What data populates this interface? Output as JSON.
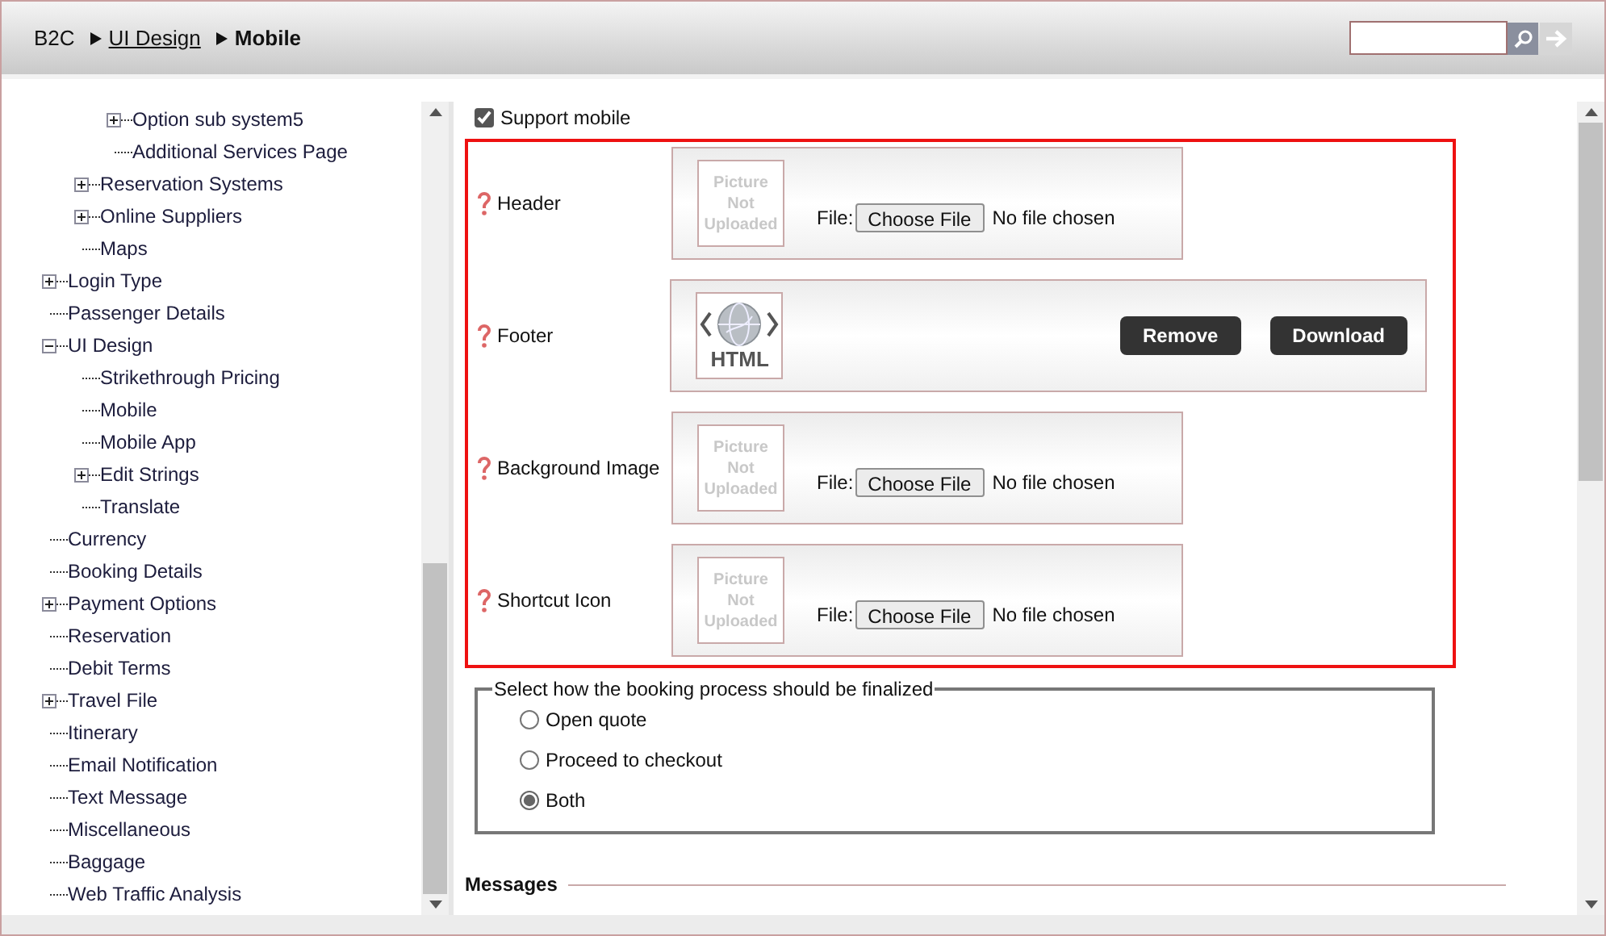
{
  "breadcrumb": [
    {
      "label": "B2C",
      "kind": "text"
    },
    {
      "label": "UI Design",
      "kind": "link"
    },
    {
      "label": "Mobile",
      "kind": "current"
    }
  ],
  "tree": [
    {
      "children": [
        {
          "children": [
            {
              "label": "Option sub system5",
              "expanded": false
            },
            {
              "label": "Additional Services Page"
            }
          ]
        },
        {
          "label": "Reservation Systems",
          "expanded": false
        },
        {
          "label": "Online Suppliers",
          "expanded": false
        },
        {
          "label": "Maps"
        }
      ]
    },
    {
      "label": "Login Type",
      "expanded": false
    },
    {
      "label": "Passenger Details"
    },
    {
      "label": "UI Design",
      "expanded": true,
      "children": [
        {
          "label": "Strikethrough Pricing"
        },
        {
          "label": "Mobile"
        },
        {
          "label": "Mobile App"
        },
        {
          "label": "Edit Strings",
          "expanded": false
        },
        {
          "label": "Translate"
        }
      ]
    },
    {
      "label": "Currency"
    },
    {
      "label": "Booking Details"
    },
    {
      "label": "Payment Options",
      "expanded": false
    },
    {
      "label": "Reservation"
    },
    {
      "label": "Debit Terms"
    },
    {
      "label": "Travel File",
      "expanded": false
    },
    {
      "label": "Itinerary"
    },
    {
      "label": "Email Notification"
    },
    {
      "label": "Text Message"
    },
    {
      "label": "Miscellaneous"
    },
    {
      "label": "Baggage"
    },
    {
      "label": "Web Traffic Analysis"
    }
  ],
  "support_mobile": {
    "label": "Support mobile",
    "checked": true
  },
  "uploads": [
    {
      "label": "Header",
      "kind": "empty",
      "image_text": "Picture Not Uploaded",
      "file_label": "File:",
      "button": "Choose File",
      "file_status": "No file chosen"
    },
    {
      "label": "Footer",
      "kind": "uploaded",
      "file_type": "HTML",
      "buttons": [
        "Remove",
        "Download"
      ]
    },
    {
      "label": "Background Image",
      "kind": "empty",
      "image_text": "Picture Not Uploaded",
      "file_label": "File:",
      "button": "Choose File",
      "file_status": "No file chosen"
    },
    {
      "label": "Shortcut Icon",
      "kind": "empty",
      "image_text": "Picture Not Uploaded",
      "file_label": "File:",
      "button": "Choose File",
      "file_status": "No file chosen"
    }
  ],
  "finalize": {
    "legend": "Select how the booking process should be finalized",
    "options": [
      {
        "label": "Open quote",
        "selected": false
      },
      {
        "label": "Proceed to checkout",
        "selected": false
      },
      {
        "label": "Both",
        "selected": true
      }
    ]
  },
  "messages_heading": "Messages"
}
